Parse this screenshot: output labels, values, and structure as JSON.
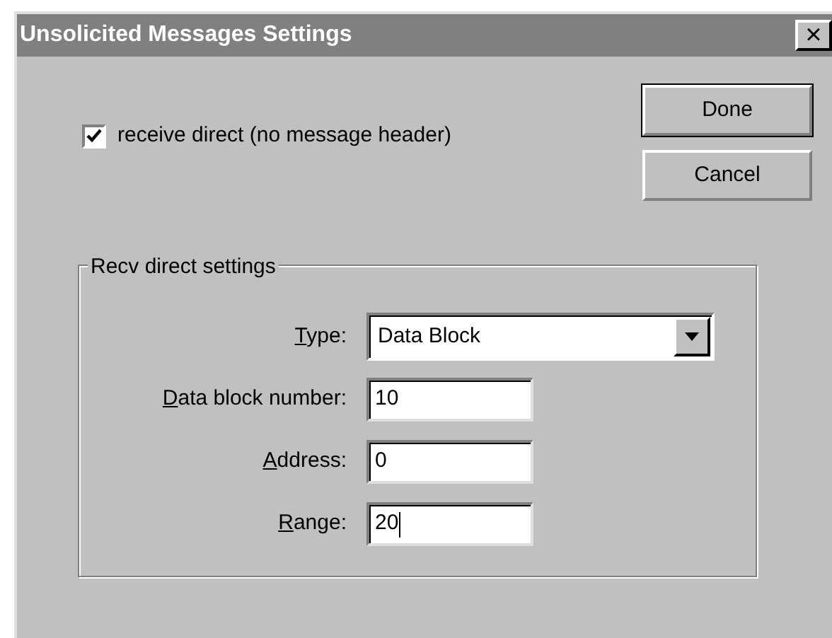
{
  "window": {
    "title": "Unsolicited Messages Settings",
    "close": "×"
  },
  "checkbox": {
    "label": "receive direct (no message header)",
    "checked": true
  },
  "buttons": [
    {
      "label": "Done",
      "default": true
    },
    {
      "label": "Cancel",
      "default": false
    }
  ],
  "group": {
    "title": "Recv direct settings",
    "fields": [
      {
        "kind": "dropdown",
        "label": "Type:",
        "mnemonic_underlined": true,
        "value": "Data Block"
      },
      {
        "kind": "text",
        "label": "Data block number:",
        "mnemonic_underlined": true,
        "value": "10",
        "focused": false
      },
      {
        "kind": "text",
        "label": "Address:",
        "mnemonic_underlined": true,
        "value": "0",
        "focused": false
      },
      {
        "kind": "text",
        "label": "Range:",
        "mnemonic_underlined": true,
        "value": "20",
        "focused": true
      }
    ]
  }
}
